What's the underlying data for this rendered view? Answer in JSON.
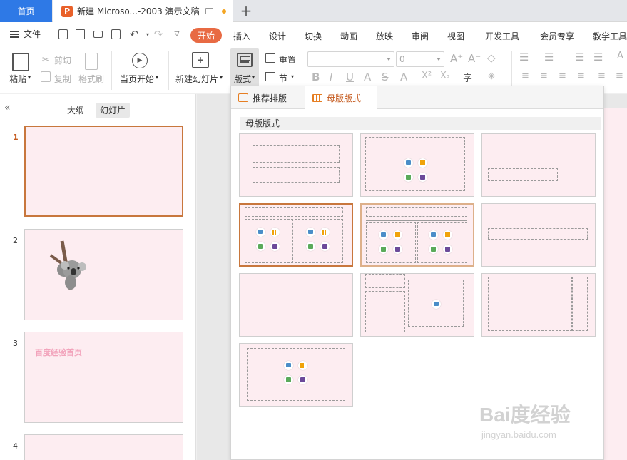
{
  "tabs": {
    "home": "首页",
    "doc_logo": "P",
    "doc_title": "新建 Microso...-2003 演示文稿",
    "add": "+"
  },
  "menu": {
    "file": "文件",
    "start": "开始",
    "items": [
      "插入",
      "设计",
      "切换",
      "动画",
      "放映",
      "审阅",
      "视图",
      "开发工具",
      "会员专享",
      "教学工具"
    ]
  },
  "ribbon": {
    "paste": "粘贴",
    "cut": "剪切",
    "copy": "复制",
    "format_painter": "格式刷",
    "from_current": "当页开始",
    "new_slide": "新建幻灯片",
    "layout": "版式",
    "reset": "重置",
    "section": "节",
    "font_size": "0"
  },
  "left_pane": {
    "outline_tab": "大纲",
    "slides_tab": "幻灯片",
    "slide_numbers": [
      "1",
      "2",
      "3",
      "4"
    ],
    "slide3_text": "百度经验首页"
  },
  "popup": {
    "tab_recommended": "推荐排版",
    "tab_master": "母版版式",
    "section_title": "母版版式"
  },
  "watermark": {
    "brand": "Bai度经验",
    "url": "jingyan.baidu.com"
  },
  "colors": {
    "accent": "#e86a43",
    "home_tab": "#2e79e6",
    "selection": "#c8773d",
    "slide_bg": "#fdedf1"
  }
}
